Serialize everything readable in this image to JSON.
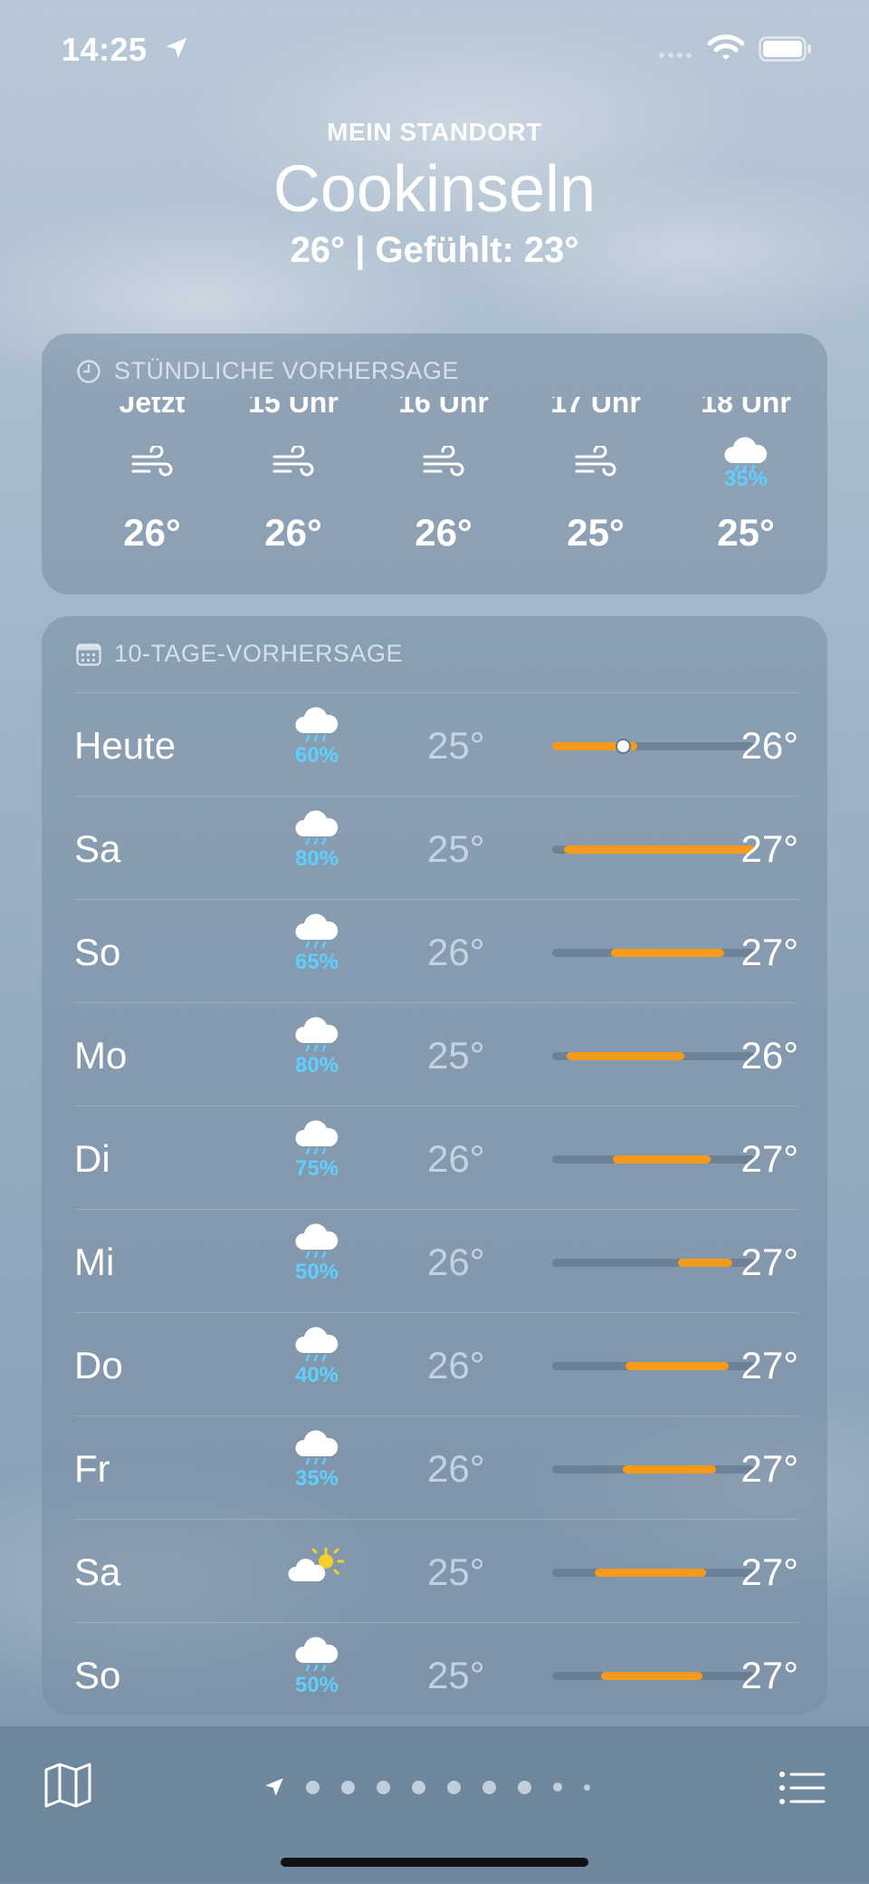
{
  "status_bar": {
    "time": "14:25"
  },
  "header": {
    "location_label": "MEIN STANDORT",
    "city": "Cookinseln",
    "current_line": "26°  |  Gefühlt: 23°"
  },
  "hourly": {
    "title": "STÜNDLICHE VORHERSAGE",
    "hours": [
      {
        "label": "Jetzt",
        "icon": "wind-icon",
        "temp": "26°"
      },
      {
        "label": "15 Uhr",
        "icon": "wind-icon",
        "temp": "26°"
      },
      {
        "label": "16 Uhr",
        "icon": "wind-icon",
        "temp": "26°"
      },
      {
        "label": "17 Uhr",
        "icon": "wind-icon",
        "temp": "25°"
      },
      {
        "label": "18 Uhr",
        "icon": "cloud-rain-icon",
        "pop": "35%",
        "temp": "25°"
      }
    ]
  },
  "tenday": {
    "title": "10-TAGE-VORHERSAGE",
    "days": [
      {
        "day": "Heute",
        "icon": "cloud-rain-icon",
        "pop": "60%",
        "low": "25°",
        "high": "26°",
        "bar_start": 0.0,
        "bar_end": 0.42,
        "current": 0.35
      },
      {
        "day": "Sa",
        "icon": "cloud-rain-icon",
        "pop": "80%",
        "low": "25°",
        "high": "27°",
        "bar_start": 0.06,
        "bar_end": 1.0
      },
      {
        "day": "So",
        "icon": "cloud-rain-icon",
        "pop": "65%",
        "low": "26°",
        "high": "27°",
        "bar_start": 0.29,
        "bar_end": 0.85
      },
      {
        "day": "Mo",
        "icon": "cloud-rain-icon",
        "pop": "80%",
        "low": "25°",
        "high": "26°",
        "bar_start": 0.07,
        "bar_end": 0.65
      },
      {
        "day": "Di",
        "icon": "cloud-rain-icon",
        "pop": "75%",
        "low": "26°",
        "high": "27°",
        "bar_start": 0.3,
        "bar_end": 0.78
      },
      {
        "day": "Mi",
        "icon": "cloud-rain-icon",
        "pop": "50%",
        "low": "26°",
        "high": "27°",
        "bar_start": 0.62,
        "bar_end": 0.89
      },
      {
        "day": "Do",
        "icon": "cloud-rain-icon",
        "pop": "40%",
        "low": "26°",
        "high": "27°",
        "bar_start": 0.36,
        "bar_end": 0.87
      },
      {
        "day": "Fr",
        "icon": "cloud-rain-icon",
        "pop": "35%",
        "low": "26°",
        "high": "27°",
        "bar_start": 0.35,
        "bar_end": 0.81
      },
      {
        "day": "Sa",
        "icon": "partly-sunny-icon",
        "pop": "",
        "low": "25°",
        "high": "27°",
        "bar_start": 0.21,
        "bar_end": 0.76
      },
      {
        "day": "So",
        "icon": "cloud-rain-icon",
        "pop": "50%",
        "low": "25°",
        "high": "27°",
        "bar_start": 0.24,
        "bar_end": 0.74
      }
    ]
  },
  "colors": {
    "temp_bar": "#f59a1a",
    "precip": "#5ed0ff"
  }
}
